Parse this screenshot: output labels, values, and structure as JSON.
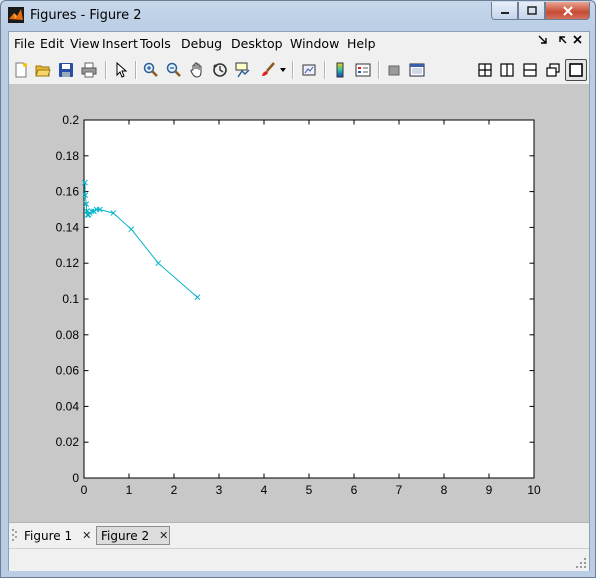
{
  "window": {
    "title": "Figures - Figure 2"
  },
  "menu": {
    "items": [
      "File",
      "Edit",
      "View",
      "Insert",
      "Tools",
      "Debug",
      "Desktop",
      "Window",
      "Help"
    ]
  },
  "toolbar": {
    "buttons": [
      "new-figure-icon",
      "open-file-icon",
      "save-icon",
      "print-icon",
      "edit-plot-arrow-icon",
      "zoom-in-icon",
      "zoom-out-icon",
      "pan-hand-icon",
      "rotate-3d-icon",
      "data-cursor-icon",
      "brush-icon",
      "brush-dropdown-icon",
      "link-plot-icon",
      "colorbar-icon",
      "legend-icon",
      "hide-plot-tools-icon",
      "show-plot-tools-icon",
      "tile-icon",
      "left-right-icon",
      "top-bottom-icon",
      "float-icon",
      "maximize-icon"
    ]
  },
  "tabs": [
    {
      "label": "Figure 1",
      "active": false
    },
    {
      "label": "Figure 2",
      "active": true
    }
  ],
  "chart_data": {
    "type": "line",
    "series": [
      {
        "color": "#00b3c8",
        "marker": "x",
        "x": [
          0.02,
          0.03,
          0.05,
          0.06,
          0.08,
          0.1,
          0.13,
          0.17,
          0.22,
          0.28,
          0.35,
          0.65,
          1.05,
          1.65,
          2.52
        ],
        "y": [
          0.165,
          0.158,
          0.153,
          0.149,
          0.147,
          0.147,
          0.148,
          0.149,
          0.149,
          0.15,
          0.15,
          0.148,
          0.139,
          0.12,
          0.101
        ]
      }
    ],
    "xlim": [
      0,
      10
    ],
    "ylim": [
      0,
      0.2
    ],
    "xticks": [
      "0",
      "1",
      "2",
      "3",
      "4",
      "5",
      "6",
      "7",
      "8",
      "9",
      "10"
    ],
    "yticks": [
      "0",
      "0.02",
      "0.04",
      "0.06",
      "0.08",
      "0.1",
      "0.12",
      "0.14",
      "0.16",
      "0.18",
      "0.2"
    ],
    "grid": false
  },
  "colors": {
    "figure_bg": "#c8c8c8",
    "axes_bg": "#ffffff",
    "line": "#00b3c8"
  }
}
